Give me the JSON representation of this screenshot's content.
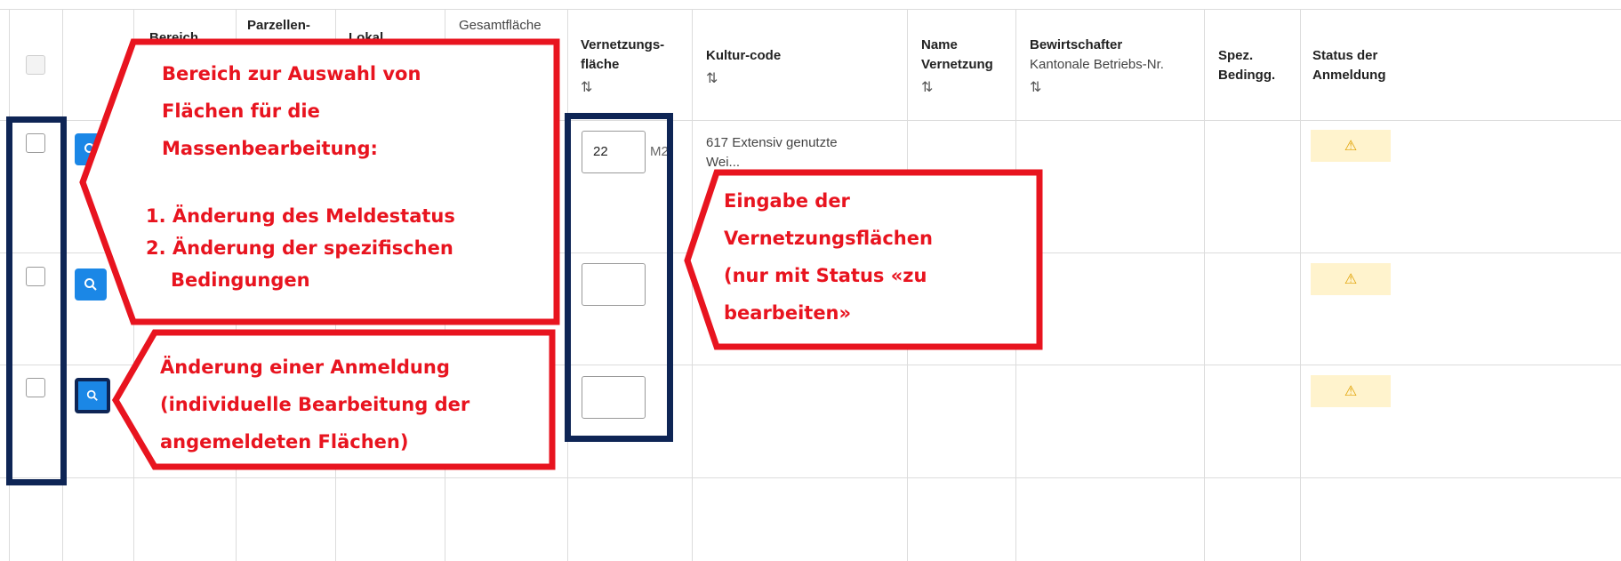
{
  "columns": {
    "bereich": "Bereich",
    "parzellen_top": "Parzellen-",
    "lokal": "Lokal",
    "gesamtflaeche": "Gesamtfläche",
    "vernetzung": [
      "Vernetzungs-",
      "fläche"
    ],
    "kultur": "Kultur-code",
    "name": [
      "Name",
      "Vernetzung"
    ],
    "bewirtschafter": "Bewirtschafter",
    "bewirtschafter_sub": "Kantonale Betriebs-Nr.",
    "spez": [
      "Spez.",
      "Bedingg."
    ],
    "status": [
      "Status der",
      "Anmeldung"
    ],
    "sort_icon": "⇅"
  },
  "rows": [
    {
      "area_value": "22",
      "unit": "M2",
      "kultur": [
        "617 Extensiv genutzte",
        "Wei..."
      ]
    },
    {
      "area_value": "",
      "unit": "",
      "kultur": []
    },
    {
      "area_value": "",
      "unit": "",
      "kultur": []
    }
  ],
  "status_icon": "⚠",
  "annotations": {
    "bulk": {
      "lines": [
        "Bereich zur Auswahl von",
        "Flächen für die",
        "Massenbearbeitung:"
      ],
      "items": [
        "1. Änderung des Meldestatus",
        "2. Änderung der spezifischen",
        "Bedingungen"
      ]
    },
    "individual": [
      "Änderung einer Anmeldung",
      "(individuelle Bearbeitung der",
      "angemeldeten Flächen)"
    ],
    "input": [
      "Eingabe der",
      "Vernetzungsflächen",
      "(nur mit Status «zu",
      "bearbeiten»"
    ]
  },
  "colors": {
    "annotation_red": "#e8141f",
    "highlight_navy": "#0e2555",
    "primary_blue": "#1b87e6",
    "warning_bg": "#fff3cd"
  }
}
